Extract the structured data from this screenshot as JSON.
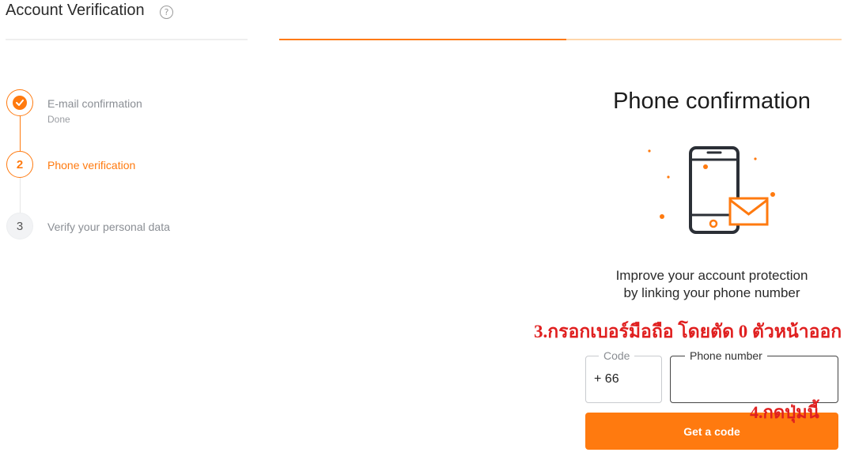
{
  "header": {
    "title": "Account Verification",
    "help_icon_glyph": "?",
    "progress_fraction": 0.51
  },
  "steps": [
    {
      "number": "1",
      "label": "E-mail confirmation",
      "sub": "Done",
      "state": "done"
    },
    {
      "number": "2",
      "label": "Phone verification",
      "state": "active"
    },
    {
      "number": "3",
      "label": "Verify your personal data",
      "state": "pending"
    }
  ],
  "panel": {
    "title": "Phone confirmation",
    "illustration_icon": "phone-envelope-icon",
    "desc_line1": "Improve your account protection",
    "desc_line2": "by linking your phone number",
    "code_legend": "Code",
    "code_value": "+ 66",
    "phone_legend": "Phone number",
    "phone_value": "",
    "cta_label": "Get a code"
  },
  "annotations": {
    "note_3": "3.กรอกเบอร์มือถือ โดยตัด 0 ตัวหน้าออก",
    "note_4": "4.กดปุ่มนี้"
  },
  "colors": {
    "accent": "#ff7a0f",
    "accent_light": "#ffd6aa",
    "annotation_red": "#e02020"
  }
}
